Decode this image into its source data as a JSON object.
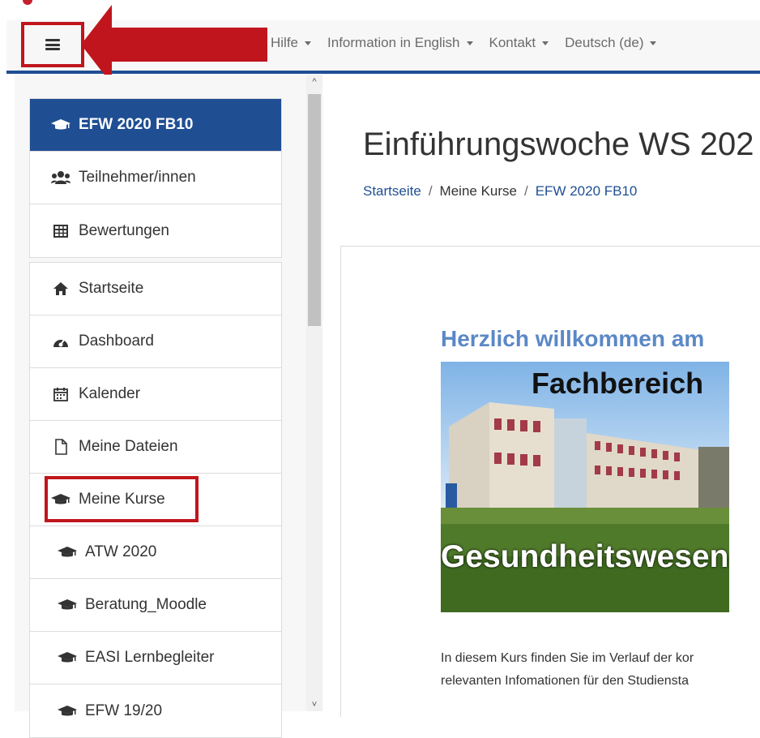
{
  "navbar": {
    "menu": [
      {
        "label": "Hilfe"
      },
      {
        "label": "Information in English"
      },
      {
        "label": "Kontakt"
      },
      {
        "label": "Deutsch (de)"
      }
    ]
  },
  "drawer": {
    "course_group": [
      {
        "label": "EFW 2020 FB10",
        "icon": "graduation-cap-icon",
        "active": true
      },
      {
        "label": "Teilnehmer/innen",
        "icon": "users-icon"
      },
      {
        "label": "Bewertungen",
        "icon": "table-icon"
      }
    ],
    "site_group": [
      {
        "label": "Startseite",
        "icon": "home-icon"
      },
      {
        "label": "Dashboard",
        "icon": "dashboard-icon"
      },
      {
        "label": "Kalender",
        "icon": "calendar-icon"
      },
      {
        "label": "Meine Dateien",
        "icon": "file-icon"
      },
      {
        "label": "Meine Kurse",
        "icon": "graduation-cap-icon"
      },
      {
        "label": "ATW 2020",
        "icon": "graduation-cap-icon"
      },
      {
        "label": "Beratung_Moodle",
        "icon": "graduation-cap-icon"
      },
      {
        "label": "EASI Lernbegleiter",
        "icon": "graduation-cap-icon"
      },
      {
        "label": "EFW 19/20",
        "icon": "graduation-cap-icon"
      }
    ]
  },
  "main": {
    "title": "Einführungswoche WS 202",
    "breadcrumb": [
      "Startseite",
      "Meine Kurse",
      "EFW 2020 FB10"
    ],
    "welcome": "Herzlich willkommen am",
    "banner_top": "Fachbereich",
    "banner_bottom": "Gesundheitswesen",
    "paragraph": [
      "In diesem Kurs finden Sie im Verlauf der kor",
      "relevanten Infomationen für den Studiensta"
    ]
  },
  "colors": {
    "brand_blue": "#1f4e93",
    "annotation_red": "#c0151c",
    "welcome_blue": "#5b88c6"
  }
}
